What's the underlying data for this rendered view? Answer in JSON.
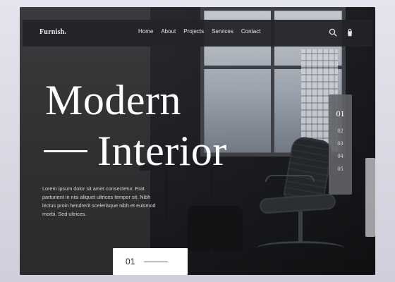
{
  "app": {
    "brand": "Furnish."
  },
  "nav": {
    "links": [
      "Home",
      "About",
      "Projects",
      "Services",
      "Contact"
    ],
    "icons": [
      "search-icon",
      "shopping-bag-icon"
    ]
  },
  "hero": {
    "title_line1": "Modern",
    "title_line2": "Interior",
    "description": "Lorem ipsum dolor sit amet consectetur. Erat parturient in nisi aliquet ultrices tempor sit. Nibh lectus proin hendrerit scelerisque nibh et euismod morbi. Sed ultrices."
  },
  "slider": {
    "items": [
      "01",
      "02",
      "03",
      "04",
      "05"
    ],
    "active_index": 0
  },
  "counter": {
    "value": "01"
  },
  "colors": {
    "background": "#1f2024",
    "nav_bg": "#232427",
    "panel": "#626367",
    "text": "#ffffff",
    "card": "#ffffff"
  }
}
